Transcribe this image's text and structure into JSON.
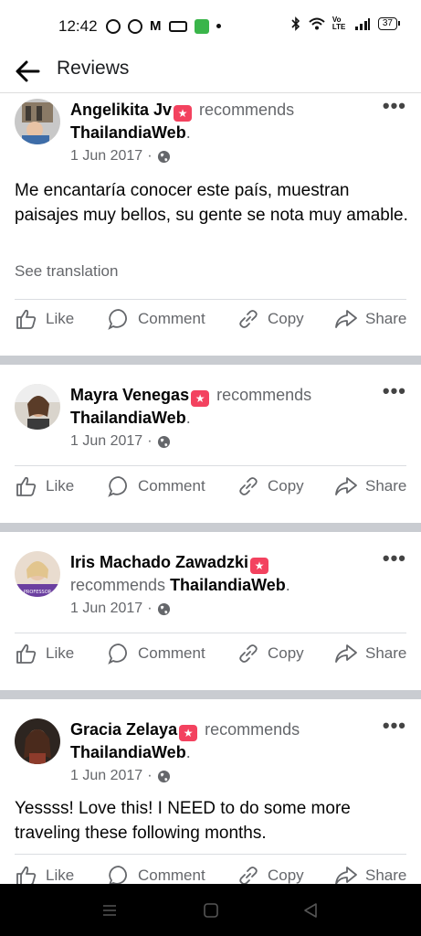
{
  "status": {
    "time": "12:42",
    "battery": "37",
    "network": "Vo LTE"
  },
  "header": {
    "title": "Reviews"
  },
  "actions": {
    "like": "Like",
    "comment": "Comment",
    "copy": "Copy",
    "share": "Share"
  },
  "posts": [
    {
      "name": "Angelikita Jv",
      "recommends": "recommends",
      "page": "ThailandiaWeb",
      "date": "1 Jun 2017",
      "text": "Me encantaría conocer este país, muestran paisajes muy bellos, su gente se nota muy amable.",
      "see_translation": "See translation"
    },
    {
      "name": "Mayra Venegas",
      "recommends": "recommends",
      "page": "ThailandiaWeb",
      "date": "1 Jun 2017"
    },
    {
      "name": "Iris Machado Zawadzki",
      "recommends": "recommends",
      "page": "ThailandiaWeb",
      "date": "1 Jun 2017"
    },
    {
      "name": "Gracia Zelaya",
      "recommends": "recommends",
      "page": "ThailandiaWeb",
      "date": "1 Jun 2017",
      "text": "Yessss! Love this! I NEED to do some more traveling these following months."
    }
  ],
  "colors": {
    "recommend_badge": "#f3425f",
    "secondary_text": "#65676b",
    "separator": "#c9ccd1"
  }
}
